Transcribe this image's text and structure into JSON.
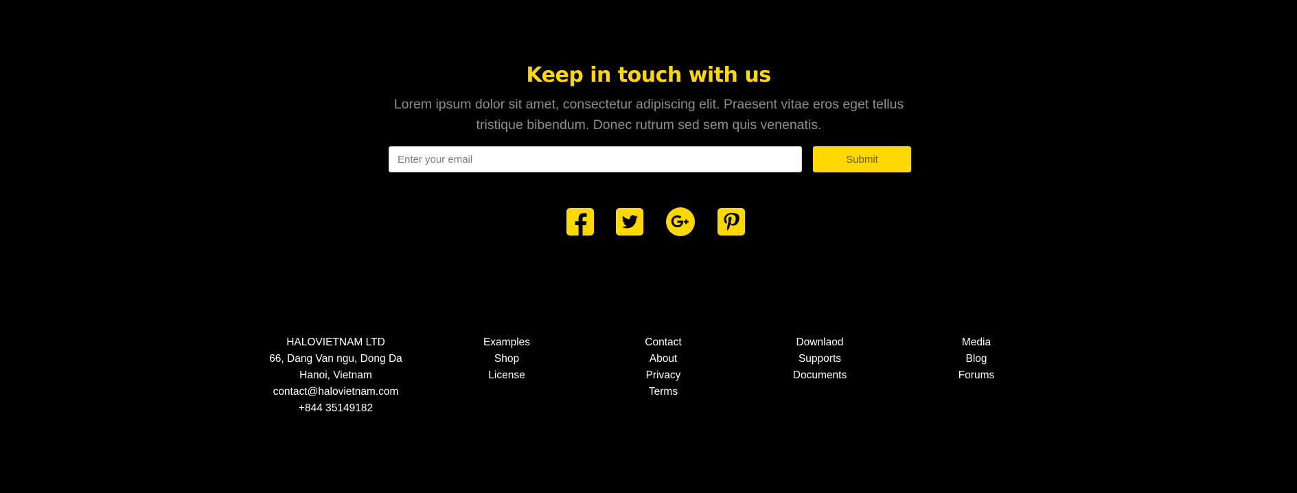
{
  "newsletter": {
    "title": "Keep in touch with us",
    "description": "Lorem ipsum dolor sit amet, consectetur adipiscing elit. Praesent vitae eros eget tellus tristique bibendum. Donec rutrum sed sem quis venenatis.",
    "email_placeholder": "Enter your email",
    "submit_label": "Submit"
  },
  "social": {
    "icons": [
      "facebook-icon",
      "twitter-icon",
      "google-plus-icon",
      "pinterest-icon"
    ],
    "accent_color": "#ffd800"
  },
  "footer": {
    "company": {
      "name": "HALOVIETNAM LTD",
      "address_line1": "66, Dang Van ngu, Dong Da",
      "address_line2": "Hanoi, Vietnam",
      "email": "contact@halovietnam.com",
      "phone": "+844 35149182"
    },
    "col1": [
      "Examples",
      "Shop",
      "License"
    ],
    "col2": [
      "Contact",
      "About",
      "Privacy",
      "Terms"
    ],
    "col3": [
      "Downlaod",
      "Supports",
      "Documents"
    ],
    "col4": [
      "Media",
      "Blog",
      "Forums"
    ]
  },
  "colors": {
    "background": "#000000",
    "accent": "#ffd800",
    "muted_text": "#8d8d8d",
    "text": "#ffffff"
  }
}
